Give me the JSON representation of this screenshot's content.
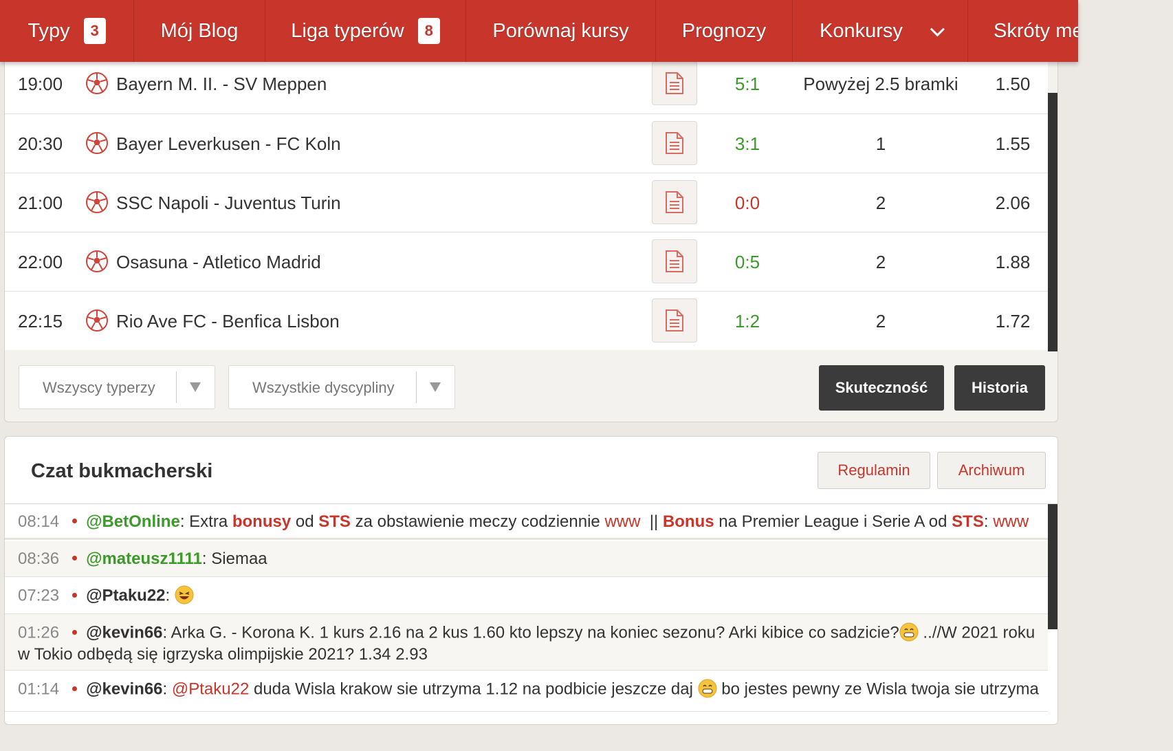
{
  "nav": {
    "items": [
      {
        "label": "Typy",
        "badge": "3"
      },
      {
        "label": "Mój Blog"
      },
      {
        "label": "Liga typerów",
        "badge": "8"
      },
      {
        "label": "Porównaj kursy"
      },
      {
        "label": "Prognozy"
      },
      {
        "label": "Konkursy"
      },
      {
        "label": "Skróty me"
      }
    ]
  },
  "matches": [
    {
      "time": "19:00",
      "teams": "Bayern M. II. - SV Meppen",
      "result": "5:1",
      "result_status": "win",
      "pick": "Powyżej 2.5 bramki",
      "odds": "1.50"
    },
    {
      "time": "20:30",
      "teams": "Bayer Leverkusen - FC Koln",
      "result": "3:1",
      "result_status": "win",
      "pick": "1",
      "odds": "1.55"
    },
    {
      "time": "21:00",
      "teams": "SSC Napoli - Juventus Turin",
      "result": "0:0",
      "result_status": "loss",
      "pick": "2",
      "odds": "2.06"
    },
    {
      "time": "22:00",
      "teams": "Osasuna - Atletico Madrid",
      "result": "0:5",
      "result_status": "win",
      "pick": "2",
      "odds": "1.88"
    },
    {
      "time": "22:15",
      "teams": "Rio Ave FC - Benfica Lisbon",
      "result": "1:2",
      "result_status": "win",
      "pick": "2",
      "odds": "1.72"
    }
  ],
  "filters": {
    "typers": "Wszyscy typerzy",
    "disciplines": "Wszystkie dyscypliny",
    "effectiveness_button": "Skuteczność",
    "history_button": "Historia"
  },
  "chat": {
    "title": "Czat bukmacherski",
    "rules_button": "Regulamin",
    "archive_button": "Archiwum",
    "messages": [
      {
        "time": "08:14",
        "user": "@BetOnline",
        "parts": [
          ": Extra ",
          "bonusy",
          " od ",
          "STS",
          " za obstawienie meczy codziennie ",
          "www",
          "  || ",
          "Bonus",
          " na Premier League i Serie A od ",
          "STS",
          ": ",
          "www"
        ]
      },
      {
        "time": "08:36",
        "user": "@mateusz1111",
        "text": ": Siemaa"
      },
      {
        "time": "07:23",
        "user": "@Ptaku22",
        "text": ":"
      },
      {
        "time": "01:26",
        "user": "@kevin66",
        "text": ": Arka G. - Korona K. 1 kurs 2.16 na 2 kus 1.60 kto lepszy na koniec sezonu? Arki kibice co sadzicie?",
        "text2": " ..//W 2021 roku w Tokio odbędą się igrzyska olimpijskie 2021? 1.34 2.93"
      },
      {
        "time": "01:14",
        "user": "@kevin66",
        "mention": "@Ptaku22",
        "text": " duda Wisla krakow sie utrzyma 1.12 na podbicie jeszcze daj ",
        "text2": " bo jestes pewny ze Wisla twoja sie utrzyma"
      }
    ]
  }
}
